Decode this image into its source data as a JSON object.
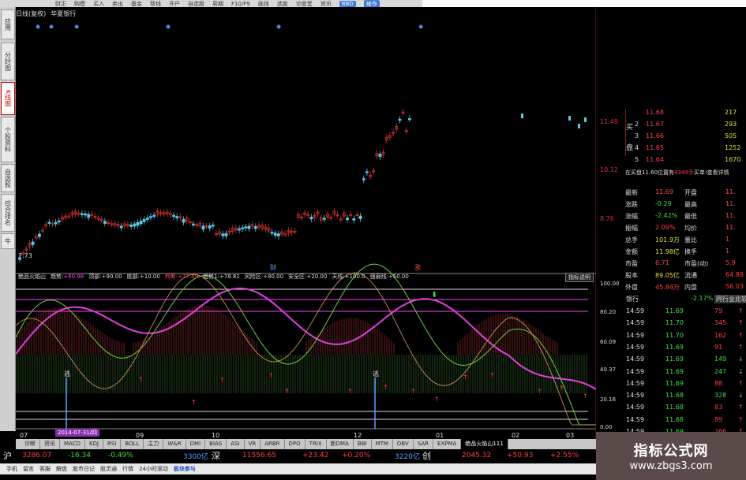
{
  "toolbar": {
    "items": [
      "财正",
      "购模",
      "买入",
      "卖出",
      "基金",
      "帮线",
      "开户",
      "自选股",
      "周期",
      "F10/F9",
      "画线",
      "选股",
      "论股堂",
      "资讯",
      "BBD",
      "操作"
    ]
  },
  "title": {
    "chart_mode": "日线(复权)",
    "stock_name": "华夏银行"
  },
  "sidebar": {
    "tabs": [
      "应用",
      "分时图",
      "K线图",
      "个股资料",
      "自选股",
      "综合排名",
      "牛"
    ]
  },
  "price_axis": {
    "main": [
      "11.49",
      "10.12",
      "8.76"
    ],
    "low_label": "7.73"
  },
  "indicator": {
    "title": "绝品火焰山",
    "trend_label": "趋势:",
    "trend_val": "+60.98",
    "top_label": "顶部:",
    "top_val": "+90.00",
    "bottom_label": "底部:",
    "bottom_val": "+10.00",
    "judge_label": "判断:",
    "judge_val": "+77.49",
    "t1_label": "趋势1:",
    "t1_val": "+78.81",
    "risk_label": "风险区:",
    "risk_val": "+80.00",
    "safe_label": "安全区:",
    "safe_val": "+20.00",
    "sky_label": "天线:",
    "sky_val": "+100.0",
    "strong_label": "强弱线:",
    "strong_val": "+50.00",
    "help_button": "指标说明",
    "axis": [
      "100.00",
      "80.20",
      "60.09",
      "40.37",
      "20.16",
      "0.00"
    ]
  },
  "markers": {
    "cai": "财",
    "zhang": "涨",
    "dian1": "逃",
    "dian2": "逃"
  },
  "date_axis": [
    "07",
    "09",
    "10",
    "12",
    "01",
    "02",
    "03"
  ],
  "selected_date": "2014-07-31/四",
  "tabs": [
    "诊断",
    "资讯",
    "MACD",
    "KDJ",
    "RSI",
    "BOLL",
    "主力",
    "W&R",
    "DMI",
    "BIAS",
    "ASI",
    "VR",
    "ARBR",
    "DPO",
    "TRIX",
    "新DMA",
    "BBI",
    "MTM",
    "OBV",
    "SAR",
    "EXPMA",
    "绝品火焰山111"
  ],
  "index_bar": {
    "hu": "沪",
    "hu_val": "3286.07",
    "hu_chg": "-16.34",
    "hu_pct": "-0.49%",
    "hu_amt": "3300亿",
    "shen": "深",
    "shen_val": "11556.65",
    "shen_chg": "+23.42",
    "shen_pct": "+0.20%",
    "shen_amt": "3220亿",
    "chuang": "创",
    "chuang_val": "2045.32",
    "chuang_chg": "+50.93",
    "chuang_pct": "+2.55%"
  },
  "bottom_menu": [
    "手机",
    "留言",
    "客服",
    "解盘",
    "股市日记",
    "股灵通",
    "行情",
    "24小时滚动",
    "板块参与"
  ],
  "orderbook": {
    "side_label_buy": "买",
    "side_label_pan": "盘",
    "rows": [
      {
        "n": "",
        "price": "11.68",
        "vol": "217"
      },
      {
        "n": "2",
        "price": "11.67",
        "vol": "293"
      },
      {
        "n": "3",
        "price": "11.66",
        "vol": "505"
      },
      {
        "n": "4",
        "price": "11.65",
        "vol": "1252"
      },
      {
        "n": "5",
        "price": "11.64",
        "vol": "1670"
      }
    ],
    "buy_info": "在买盘11.60位置有",
    "buy_info_val": "4349手",
    "buy_info_tail": "买单!查看详情"
  },
  "quote": {
    "rows": [
      [
        "最新",
        "11.69",
        "开盘",
        "11."
      ],
      [
        "涨跌",
        "-0.29",
        "最高",
        "11."
      ],
      [
        "涨幅",
        "-2.42%",
        "最低",
        "11."
      ],
      [
        "振幅",
        "2.09%",
        "均价",
        "11."
      ],
      [
        "总手",
        "101.9万",
        "量比",
        "1"
      ],
      [
        "金额",
        "11.98亿",
        "换手",
        "1"
      ],
      [
        "市盈",
        "6.71",
        "市盈(动)",
        "5.9"
      ],
      [
        "股本",
        "89.05亿",
        "流通",
        "64.88"
      ],
      [
        "外盘",
        "45.84万",
        "内盘",
        "56.03"
      ]
    ],
    "sector": "银行",
    "sector_pct": "-2.17%",
    "sector_link": "同行业比较"
  },
  "trades": [
    [
      "14:59",
      "11.69",
      "79"
    ],
    [
      "14:59",
      "11.70",
      "345"
    ],
    [
      "14:59",
      "11.70",
      "162"
    ],
    [
      "14:59",
      "11.69",
      "91"
    ],
    [
      "14:59",
      "11.69",
      "149"
    ],
    [
      "14:59",
      "11.69",
      "247"
    ],
    [
      "14:59",
      "11.69",
      "88"
    ],
    [
      "14:59",
      "11.68",
      "328"
    ],
    [
      "14:59",
      "11.68",
      "83"
    ],
    [
      "14:59",
      "11.68",
      "89"
    ],
    [
      "14:59",
      "11.69",
      "266"
    ]
  ],
  "watermark": {
    "title": "指标公式网",
    "url": "www.zbgs3.com"
  }
}
